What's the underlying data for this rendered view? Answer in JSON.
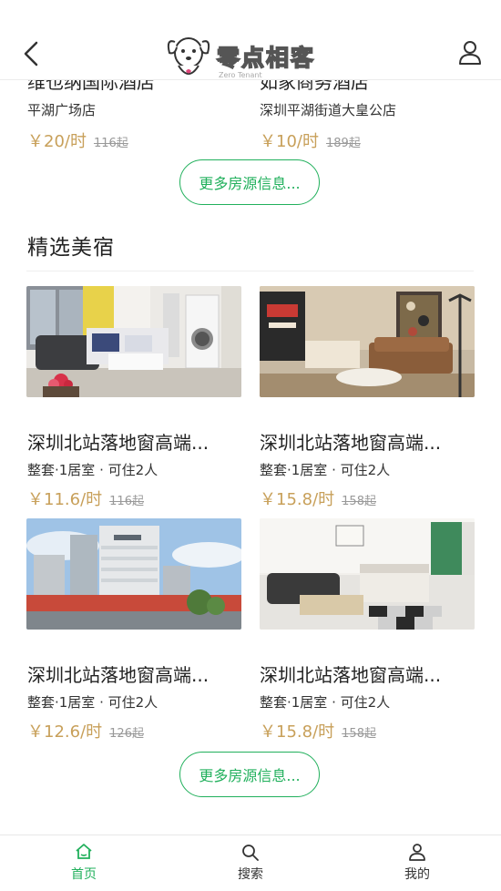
{
  "header": {
    "logo_text": "零点相客",
    "logo_sub": "Zero Tenant"
  },
  "top_hotels": [
    {
      "name": "维也纳国际酒店",
      "address": "平湖广场店",
      "price": "￥20/时",
      "original": "116起"
    },
    {
      "name": "如家商务酒店",
      "address": "深圳平湖街道大皇公店",
      "price": "￥10/时",
      "original": "189起"
    }
  ],
  "more_button_1": "更多房源信息...",
  "section": {
    "title": "精选美宿",
    "cards": [
      {
        "title": "深圳北站落地窗高端...",
        "sub": "整套·1居室 · 可住2人",
        "price": "￥11.6/时",
        "original": "116起"
      },
      {
        "title": "深圳北站落地窗高端...",
        "sub": "整套·1居室 · 可住2人",
        "price": "￥15.8/时",
        "original": "158起"
      },
      {
        "title": "深圳北站落地窗高端...",
        "sub": "整套·1居室 · 可住2人",
        "price": "￥12.6/时",
        "original": "126起"
      },
      {
        "title": "深圳北站落地窗高端...",
        "sub": "整套·1居室 · 可住2人",
        "price": "￥15.8/时",
        "original": "158起"
      }
    ]
  },
  "more_button_2": "更多房源信息...",
  "tabs": [
    {
      "label": "首页",
      "icon": "home-icon",
      "active": true
    },
    {
      "label": "搜索",
      "icon": "search-icon",
      "active": false
    },
    {
      "label": "我的",
      "icon": "user-icon",
      "active": false
    }
  ],
  "colors": {
    "accent": "#21b05c",
    "price": "#c8a05a",
    "text": "#222222"
  }
}
